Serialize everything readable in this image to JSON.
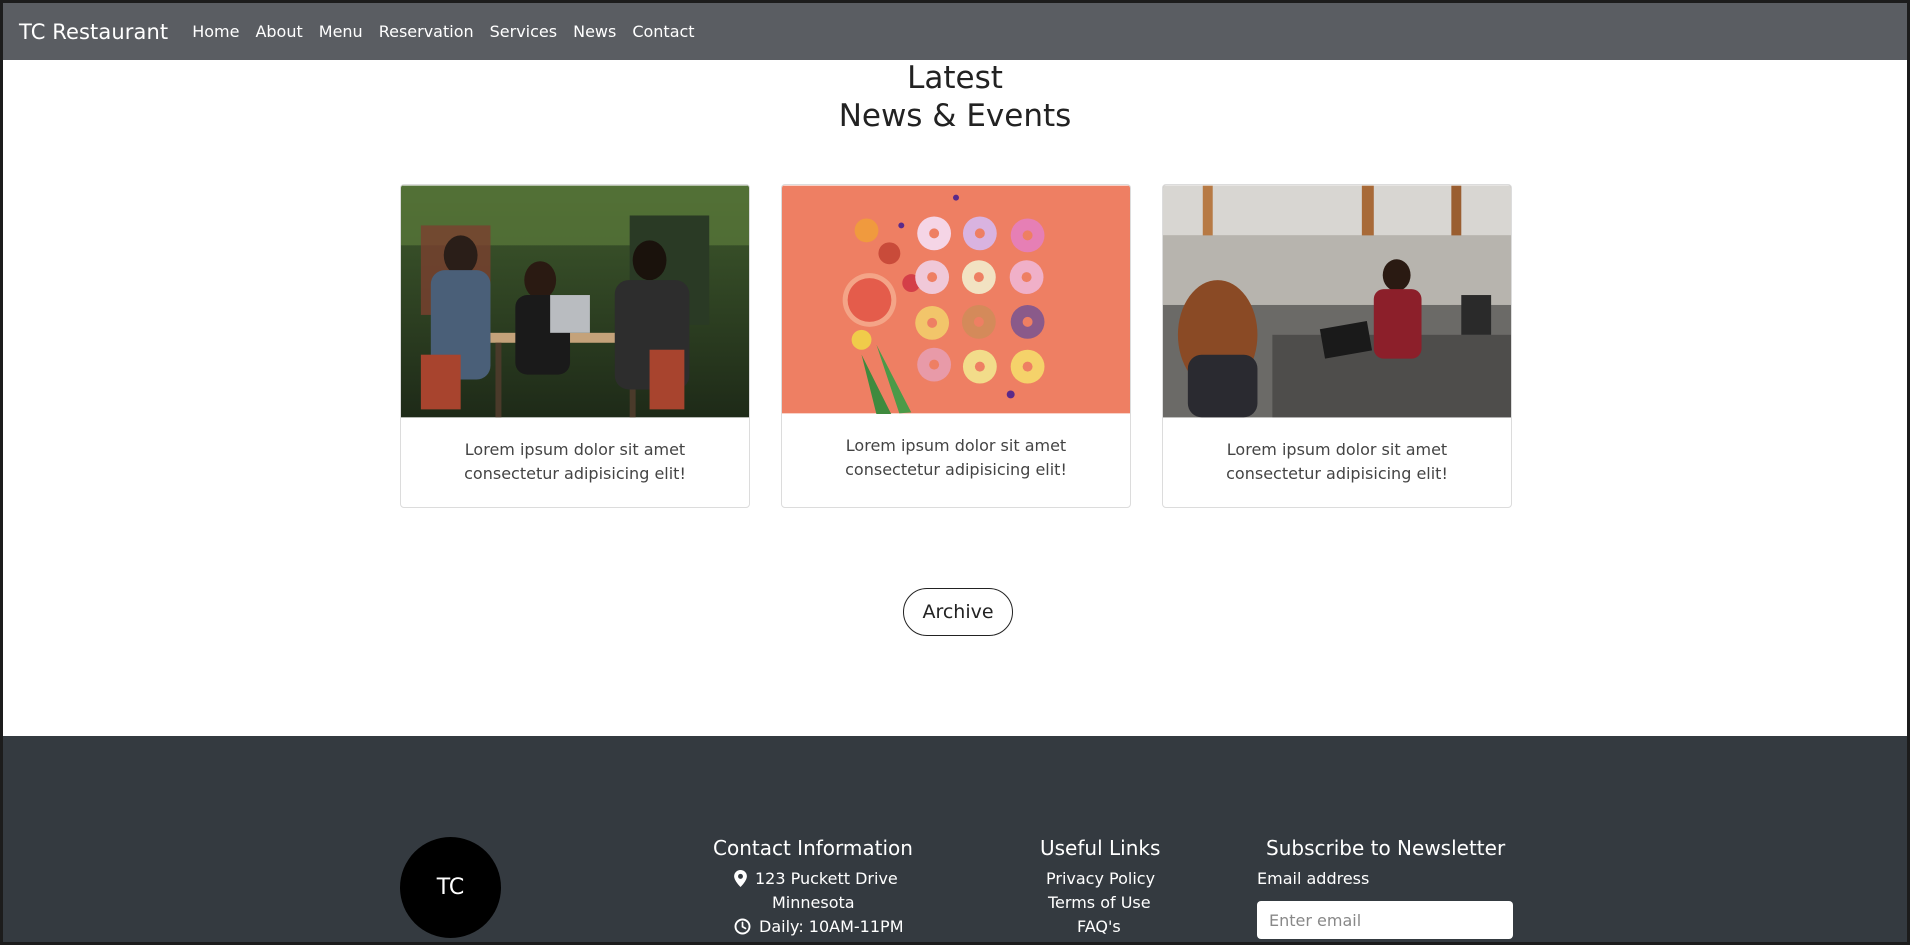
{
  "navbar": {
    "brand": "TC Restaurant",
    "links": [
      "Home",
      "About",
      "Menu",
      "Reservation",
      "Services",
      "News",
      "Contact"
    ]
  },
  "section": {
    "title_line1": "Latest",
    "title_line2": "News & Events"
  },
  "cards": [
    {
      "text": "Lorem ipsum dolor sit amet consectetur adipisicing elit!"
    },
    {
      "text": "Lorem ipsum dolor sit amet consectetur adipisicing elit!"
    },
    {
      "text": "Lorem ipsum dolor sit amet consectetur adipisicing elit!"
    }
  ],
  "archive_label": "Archive",
  "footer": {
    "logo_text": "TC",
    "contact": {
      "title": "Contact Information",
      "address_line1": "123 Puckett Drive",
      "address_line2": "Minnesota",
      "hours": "Daily: 10AM-11PM"
    },
    "links": {
      "title": "Useful Links",
      "items": [
        "Privacy Policy",
        "Terms of Use",
        "FAQ's"
      ]
    },
    "newsletter": {
      "title": "Subscribe to Newsletter",
      "email_label": "Email address",
      "email_placeholder": "Enter email"
    }
  }
}
